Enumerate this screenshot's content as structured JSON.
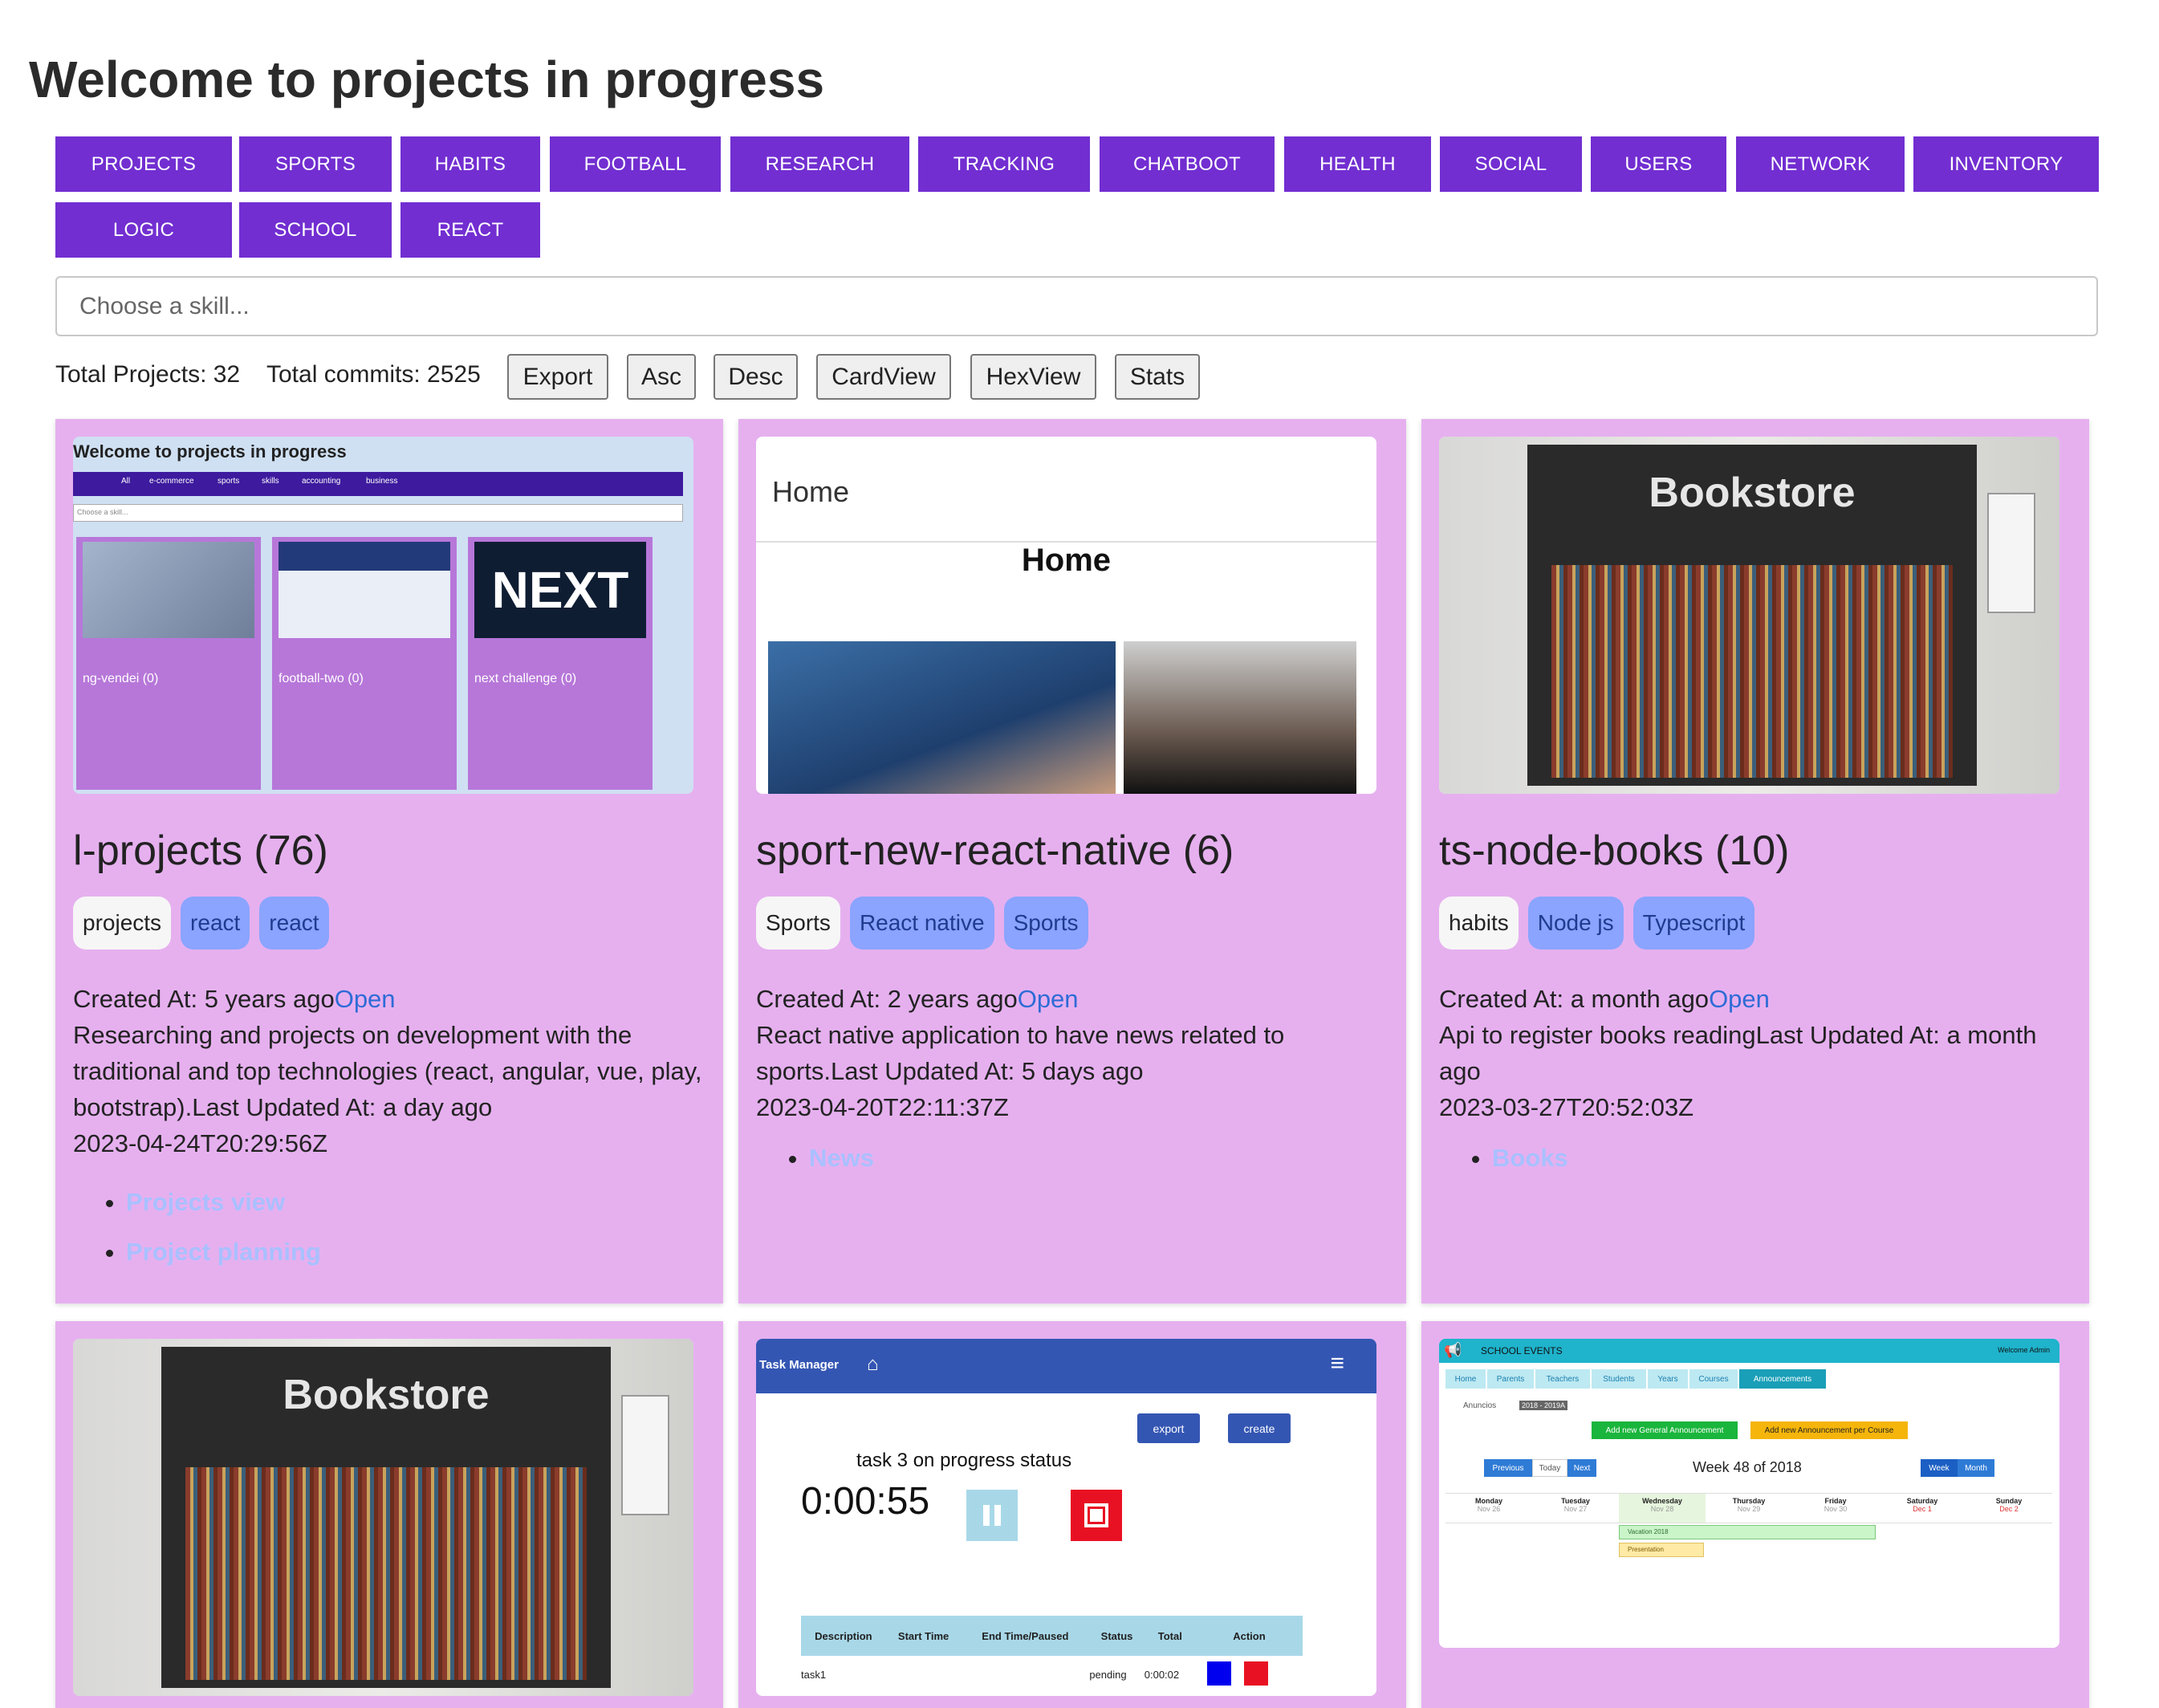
{
  "page": {
    "title": "Welcome to projects in progress"
  },
  "categories": [
    "PROJECTS",
    "SPORTS",
    "HABITS",
    "FOOTBALL",
    "RESEARCH",
    "TRACKING",
    "CHATBOOT",
    "HEALTH",
    "SOCIAL",
    "USERS",
    "NETWORK",
    "INVENTORY",
    "LOGIC",
    "SCHOOL",
    "REACT"
  ],
  "search": {
    "placeholder": "Choose a skill..."
  },
  "stats": {
    "total_projects": "Total Projects: 32",
    "total_commits": "Total commits: 2525"
  },
  "toolbar": {
    "export": "Export",
    "asc": "Asc",
    "desc": "Desc",
    "cardview": "CardView",
    "hexview": "HexView",
    "stats": "Stats"
  },
  "colors": {
    "accent": "#722ed1",
    "card_bg": "#e6b0ef",
    "tag_tech": "#8aa4ff",
    "link": "#2e6bd6"
  },
  "cards": [
    {
      "title": "l-projects (76)",
      "tags": [
        "projects",
        "react",
        "react"
      ],
      "created": "Created At: 5 years ago",
      "open": "Open",
      "description": "Researching and projects on development with the traditional and top technologies (react, angular, vue, play, bootstrap).",
      "updated": "Last Updated At: a day ago",
      "date": "2023-04-24T20:29:56Z",
      "features": [
        "Projects view",
        "Project planning"
      ],
      "thumb": {
        "title": "Welcome to projects in progress",
        "nav": [
          "All",
          "e-commerce",
          "sports",
          "skills",
          "accounting",
          "business"
        ],
        "search": "Choose a skill...",
        "mini_cards": [
          "ng-vendei (0)",
          "football-two (0)",
          "next challenge (0)"
        ]
      }
    },
    {
      "title": "sport-new-react-native (6)",
      "tags": [
        "Sports",
        "React native",
        "Sports"
      ],
      "created": "Created At: 2 years ago",
      "open": "Open",
      "description": "React native application to have news related to sports.",
      "updated": "Last Updated At: 5 days ago",
      "date": "2023-04-20T22:11:37Z",
      "features": [
        "News"
      ],
      "thumb": {
        "header": "Home",
        "heading": "Home"
      }
    },
    {
      "title": "ts-node-books (10)",
      "tags": [
        "habits",
        "Node js",
        "Typescript"
      ],
      "created": "Created At: a month ago",
      "open": "Open",
      "description": "Api to register books reading",
      "updated": "Last Updated At: a month ago",
      "date": "2023-03-27T20:52:03Z",
      "features": [
        "Books"
      ],
      "thumb": {
        "sign": "Bookstore"
      }
    }
  ],
  "row2": {
    "bookstore_sign": "Bookstore",
    "task_manager": {
      "title": "Task Manager",
      "export": "export",
      "create": "create",
      "status": "task 3 on progress status",
      "timer": "0:00:55",
      "columns": [
        "Description",
        "Start Time",
        "End Time/Paused",
        "Status",
        "Total",
        "Action"
      ],
      "row": {
        "description": "task1",
        "status": "pending",
        "total": "0:00:02"
      }
    },
    "school_events": {
      "title": "SCHOOL EVENTS",
      "user": "Welcome Admin",
      "tabs": [
        "Home",
        "Parents",
        "Teachers",
        "Students",
        "Years",
        "Courses",
        "Announcements"
      ],
      "anuncios": "Anuncios",
      "year": "2018 - 2019A",
      "add_general": "Add new General Announcement",
      "add_course": "Add new Announcement per Course",
      "prev": "Previous",
      "today": "Today",
      "next": "Next",
      "week_label": "Week 48 of 2018",
      "week": "Week",
      "month": "Month",
      "days": [
        "Monday",
        "Tuesday",
        "Wednesday",
        "Thursday",
        "Friday",
        "Saturday",
        "Sunday"
      ],
      "dates": [
        "Nov 26",
        "Nov 27",
        "Nov 28",
        "Nov 29",
        "Nov 30",
        "Dec 1",
        "Dec 2"
      ],
      "events": [
        "Vacation 2018",
        "Presentation"
      ]
    }
  }
}
